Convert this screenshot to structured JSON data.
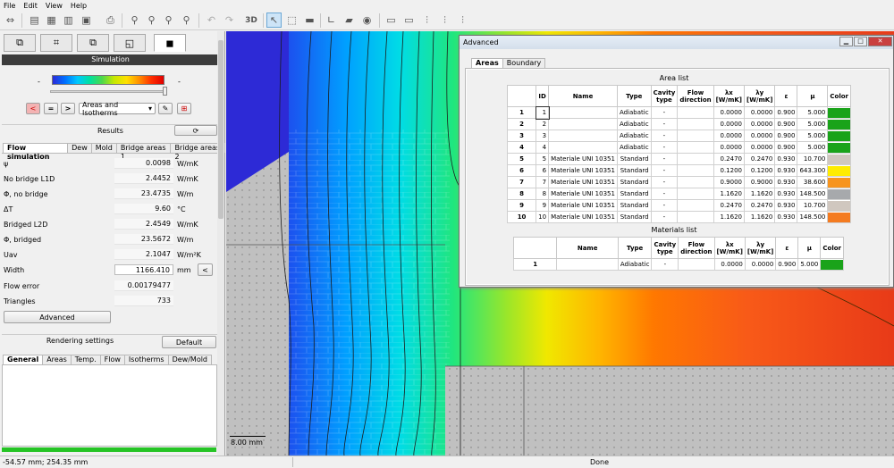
{
  "menu": [
    "File",
    "Edit",
    "View",
    "Help"
  ],
  "toolbar_icons": [
    "swap-icon",
    "new-file-icon",
    "open-folder-icon",
    "open-file-icon",
    "save-icon",
    "print-icon",
    "zoom-icon",
    "zoom-fit-icon",
    "zoom-in-icon",
    "zoom-out-icon",
    "undo-icon",
    "redo-icon",
    "3d-view-button",
    "select-cursor-icon",
    "select-area-icon",
    "measure-icon",
    "axis-icon",
    "comment-icon",
    "eye-icon",
    "import-icon",
    "export-icon",
    "bar-chart-icon",
    "table-icon"
  ],
  "toolbar_3d": "3D",
  "left": {
    "simulation_header": "Simulation",
    "scale_min": "-",
    "scale_max": "-",
    "btn_stop": "<",
    "btn_equal": "=",
    "btn_next": ">",
    "display_mode": "Areas and Isotherms",
    "results_label": "Results",
    "result_tabs": [
      "Flow simulation",
      "Dew",
      "Mold",
      "Bridge areas 1",
      "Bridge areas 2"
    ],
    "results": [
      {
        "label": "ψ",
        "value": "0.0098",
        "unit": "W/mK"
      },
      {
        "label": "No bridge L1D",
        "value": "2.4452",
        "unit": "W/mK"
      },
      {
        "label": "Φ, no bridge",
        "value": "23.4735",
        "unit": "W/m"
      },
      {
        "label": "ΔT",
        "value": "9.60",
        "unit": "°C"
      },
      {
        "label": "Bridged L2D",
        "value": "2.4549",
        "unit": "W/mK"
      },
      {
        "label": "Φ, bridged",
        "value": "23.5672",
        "unit": "W/m"
      },
      {
        "label": "Uav",
        "value": "2.1047",
        "unit": "W/m²K"
      },
      {
        "label": "Width",
        "value": "1166.410",
        "unit": "mm"
      },
      {
        "label": "Flow error",
        "value": "0.00179477",
        "unit": ""
      },
      {
        "label": "Triangles",
        "value": "733",
        "unit": ""
      }
    ],
    "width_button": "<",
    "advanced_button": "Advanced",
    "rendering_label": "Rendering settings",
    "default_button": "Default",
    "render_tabs": [
      "General",
      "Areas",
      "Temp.",
      "Flow",
      "Isotherms",
      "Dew/Mold"
    ]
  },
  "canvas": {
    "scale_label": "8.00 mm"
  },
  "status": {
    "coords": "-54.57 mm; 254.35 mm",
    "state": "Done"
  },
  "dialog": {
    "title": "Advanced",
    "tabs": [
      "Areas",
      "Boundary"
    ],
    "area_list_title": "Area list",
    "area_headers": [
      "ID",
      "Name",
      "Type",
      "Cavity type",
      "Flow direction",
      "λx [W/mK]",
      "λy [W/mK]",
      "ε",
      "μ",
      "Color"
    ],
    "area_rows": [
      {
        "n": "1",
        "id": "1",
        "name": "",
        "type": "Adiabatic",
        "cavity": "-",
        "flow": "",
        "lx": "0.0000",
        "ly": "0.0000",
        "e": "0.900",
        "mu": "5.000",
        "color": "#1aa31a"
      },
      {
        "n": "2",
        "id": "2",
        "name": "",
        "type": "Adiabatic",
        "cavity": "-",
        "flow": "",
        "lx": "0.0000",
        "ly": "0.0000",
        "e": "0.900",
        "mu": "5.000",
        "color": "#1aa31a"
      },
      {
        "n": "3",
        "id": "3",
        "name": "",
        "type": "Adiabatic",
        "cavity": "-",
        "flow": "",
        "lx": "0.0000",
        "ly": "0.0000",
        "e": "0.900",
        "mu": "5.000",
        "color": "#1aa31a"
      },
      {
        "n": "4",
        "id": "4",
        "name": "",
        "type": "Adiabatic",
        "cavity": "-",
        "flow": "",
        "lx": "0.0000",
        "ly": "0.0000",
        "e": "0.900",
        "mu": "5.000",
        "color": "#1aa31a"
      },
      {
        "n": "5",
        "id": "5",
        "name": "Materiale UNI 10351",
        "type": "Standard",
        "cavity": "-",
        "flow": "",
        "lx": "0.2470",
        "ly": "0.2470",
        "e": "0.930",
        "mu": "10.700",
        "color": "#d0c7bf"
      },
      {
        "n": "6",
        "id": "6",
        "name": "Materiale UNI 10351",
        "type": "Standard",
        "cavity": "-",
        "flow": "",
        "lx": "0.1200",
        "ly": "0.1200",
        "e": "0.930",
        "mu": "643.300",
        "color": "#ffec00"
      },
      {
        "n": "7",
        "id": "7",
        "name": "Materiale UNI 10351",
        "type": "Standard",
        "cavity": "-",
        "flow": "",
        "lx": "0.9000",
        "ly": "0.9000",
        "e": "0.930",
        "mu": "38.600",
        "color": "#f7941d"
      },
      {
        "n": "8",
        "id": "8",
        "name": "Materiale UNI 10351",
        "type": "Standard",
        "cavity": "-",
        "flow": "",
        "lx": "1.1620",
        "ly": "1.1620",
        "e": "0.930",
        "mu": "148.500",
        "color": "#a7a9ac"
      },
      {
        "n": "9",
        "id": "9",
        "name": "Materiale UNI 10351",
        "type": "Standard",
        "cavity": "-",
        "flow": "",
        "lx": "0.2470",
        "ly": "0.2470",
        "e": "0.930",
        "mu": "10.700",
        "color": "#d0c7bf"
      },
      {
        "n": "10",
        "id": "10",
        "name": "Materiale UNI 10351",
        "type": "Standard",
        "cavity": "-",
        "flow": "",
        "lx": "1.1620",
        "ly": "1.1620",
        "e": "0.930",
        "mu": "148.500",
        "color": "#f47b20"
      }
    ],
    "materials_list_title": "Materials list",
    "material_headers": [
      "Name",
      "Type",
      "Cavity type",
      "Flow direction",
      "λx [W/mK]",
      "λy [W/mK]",
      "ε",
      "μ",
      "Color"
    ],
    "material_rows": [
      {
        "n": "1",
        "name": "",
        "type": "Adiabatic",
        "cavity": "-",
        "flow": "",
        "lx": "0.0000",
        "ly": "0.0000",
        "e": "0.900",
        "mu": "5.000",
        "color": "#1aa31a"
      }
    ]
  }
}
